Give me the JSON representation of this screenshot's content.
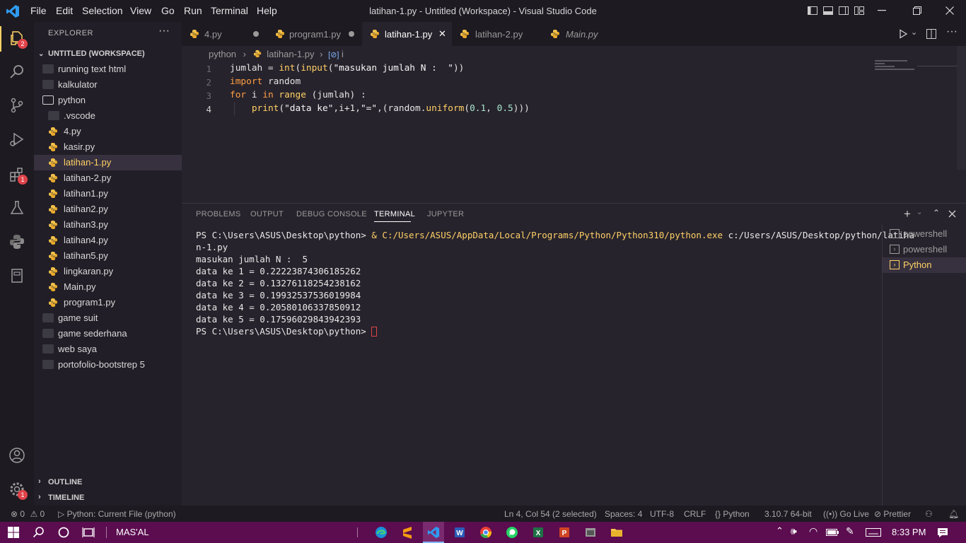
{
  "titlebar": {
    "menu": [
      "File",
      "Edit",
      "Selection",
      "View",
      "Go",
      "Run",
      "Terminal",
      "Help"
    ],
    "title": "latihan-1.py - Untitled (Workspace) - Visual Studio Code",
    "icons": [
      "toggle-sidebar-icon",
      "toggle-panel-icon",
      "toggle-secondary-sidebar-icon",
      "customize-layout-icon"
    ]
  },
  "activity": {
    "explorer_badge": "2",
    "extensions_badge": "1",
    "settings_badge": "1"
  },
  "explorer": {
    "title": "EXPLORER",
    "more": "···",
    "workspace": "UNTITLED (WORKSPACE)",
    "tree": [
      {
        "label": "running text html",
        "type": "folder",
        "depth": 0
      },
      {
        "label": "kalkulator",
        "type": "folder",
        "depth": 0
      },
      {
        "label": "python",
        "type": "folder-open",
        "depth": 0
      },
      {
        "label": ".vscode",
        "type": "folder",
        "depth": 1
      },
      {
        "label": "4.py",
        "type": "py",
        "depth": 1
      },
      {
        "label": "kasir.py",
        "type": "py",
        "depth": 1
      },
      {
        "label": "latihan-1.py",
        "type": "py",
        "depth": 1,
        "selected": true
      },
      {
        "label": "latihan-2.py",
        "type": "py",
        "depth": 1
      },
      {
        "label": "latihan1.py",
        "type": "py",
        "depth": 1
      },
      {
        "label": "latihan2.py",
        "type": "py",
        "depth": 1
      },
      {
        "label": "latihan3.py",
        "type": "py",
        "depth": 1
      },
      {
        "label": "latihan4.py",
        "type": "py",
        "depth": 1
      },
      {
        "label": "latihan5.py",
        "type": "py",
        "depth": 1
      },
      {
        "label": "lingkaran.py",
        "type": "py",
        "depth": 1
      },
      {
        "label": "Main.py",
        "type": "py",
        "depth": 1
      },
      {
        "label": "program1.py",
        "type": "py",
        "depth": 1
      },
      {
        "label": "game suit",
        "type": "folder",
        "depth": 0
      },
      {
        "label": "game sederhana",
        "type": "folder",
        "depth": 0
      },
      {
        "label": "web saya",
        "type": "folder",
        "depth": 0
      },
      {
        "label": "portofolio-bootstrep 5",
        "type": "folder",
        "depth": 0
      }
    ],
    "outline": "OUTLINE",
    "timeline": "TIMELINE"
  },
  "tabs": [
    {
      "label": "4.py",
      "modified": true
    },
    {
      "label": "program1.py",
      "modified": true
    },
    {
      "label": "latihan-1.py",
      "active": true,
      "close": "✕"
    },
    {
      "label": "latihan-2.py"
    },
    {
      "label": "Main.py",
      "italic": true
    }
  ],
  "breadcrumb": {
    "folder": "python",
    "file": "latihan-1.py",
    "symbol": "i"
  },
  "code": {
    "line_numbers": [
      "1",
      "2",
      "3",
      "4"
    ],
    "lines": [
      "jumlah = int(input(\"masukan jumlah N :  \"))",
      "import random",
      "for i in range (jumlah) :",
      "    print(\"data ke\",i+1,\"=\",(random.uniform(0.1, 0.5)))"
    ]
  },
  "panel": {
    "tabs": [
      "PROBLEMS",
      "OUTPUT",
      "DEBUG CONSOLE",
      "TERMINAL",
      "JUPYTER"
    ],
    "active_tab": "TERMINAL",
    "terminal_lines": [
      "PS C:\\Users\\ASUS\\Desktop\\python> & C:/Users/ASUS/AppData/Local/Programs/Python/Python310/python.exe c:/Users/ASUS/Desktop/python/latiha",
      "n-1.py",
      "masukan jumlah N :  5",
      "data ke 1 = 0.22223874306185262",
      "data ke 2 = 0.13276118254238162",
      "data ke 3 = 0.19932537536019984",
      "data ke 4 = 0.20580106337850912",
      "data ke 5 = 0.17596029843942393",
      "PS C:\\Users\\ASUS\\Desktop\\python> "
    ],
    "terminals": [
      {
        "label": "powershell"
      },
      {
        "label": "powershell"
      },
      {
        "label": "Python",
        "selected": true
      }
    ]
  },
  "status": {
    "errors": "0",
    "warnings": "0",
    "debug": "Python: Current File (python)",
    "position": "Ln 4, Col 54 (2 selected)",
    "spaces": "Spaces: 4",
    "encoding": "UTF-8",
    "eol": "CRLF",
    "language": "Python",
    "interpreter": "3.10.7 64-bit",
    "golive": "Go Live",
    "prettier": "Prettier"
  },
  "taskbar": {
    "label": "MAS'AL",
    "time": "8:33 PM",
    "accent": "#5b0d4f"
  }
}
